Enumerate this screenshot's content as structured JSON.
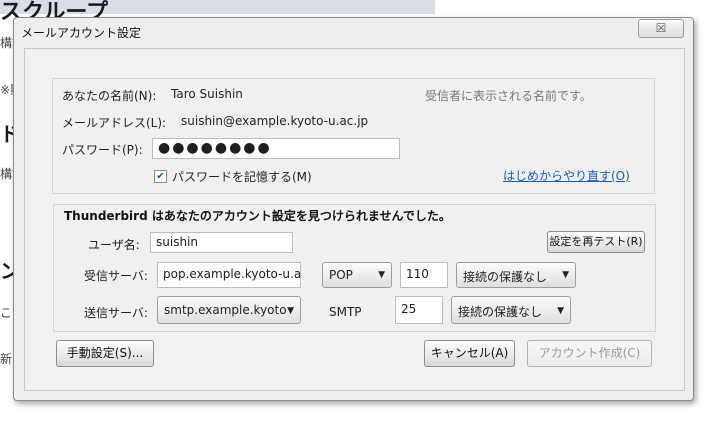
{
  "background": {
    "top_text": "スクループ",
    "side_fragments": [
      "構認",
      "※影",
      "ド",
      "構認",
      "ン",
      "この",
      "新し"
    ]
  },
  "dialog": {
    "title": "メールアカウント設定",
    "close_label": "☒",
    "name_label": "あなたの名前(N):",
    "name_value": "Taro Suishin",
    "name_hint": "受信者に表示される名前です。",
    "email_label": "メールアドレス(L):",
    "email_value": "suishin@example.kyoto-u.ac.jp",
    "password_label": "パスワード(P):",
    "password_value": "●●●●●●●●",
    "remember_label": "パスワードを記憶する(M)",
    "remember_checked": true,
    "restart_link": "はじめからやり直す(O)",
    "notice": "Thunderbird はあなたのアカウント設定を見つけられませんでした。",
    "username_label": "ユーザ名:",
    "username_value": "suishin",
    "retest_button": "設定を再テスト(R)",
    "incoming_label": "受信サーバ:",
    "incoming_server": "pop.example.kyoto-u.ac",
    "incoming_protocol": "POP",
    "incoming_port": "110",
    "incoming_security": "接続の保護なし",
    "outgoing_label": "送信サーバ:",
    "outgoing_server": "smtp.example.kyoto",
    "outgoing_protocol": "SMTP",
    "outgoing_port": "25",
    "outgoing_security": "接続の保護なし",
    "manual_button": "手動設定(S)...",
    "cancel_button": "キャンセル(A)",
    "create_button": "アカウント作成(C)"
  }
}
